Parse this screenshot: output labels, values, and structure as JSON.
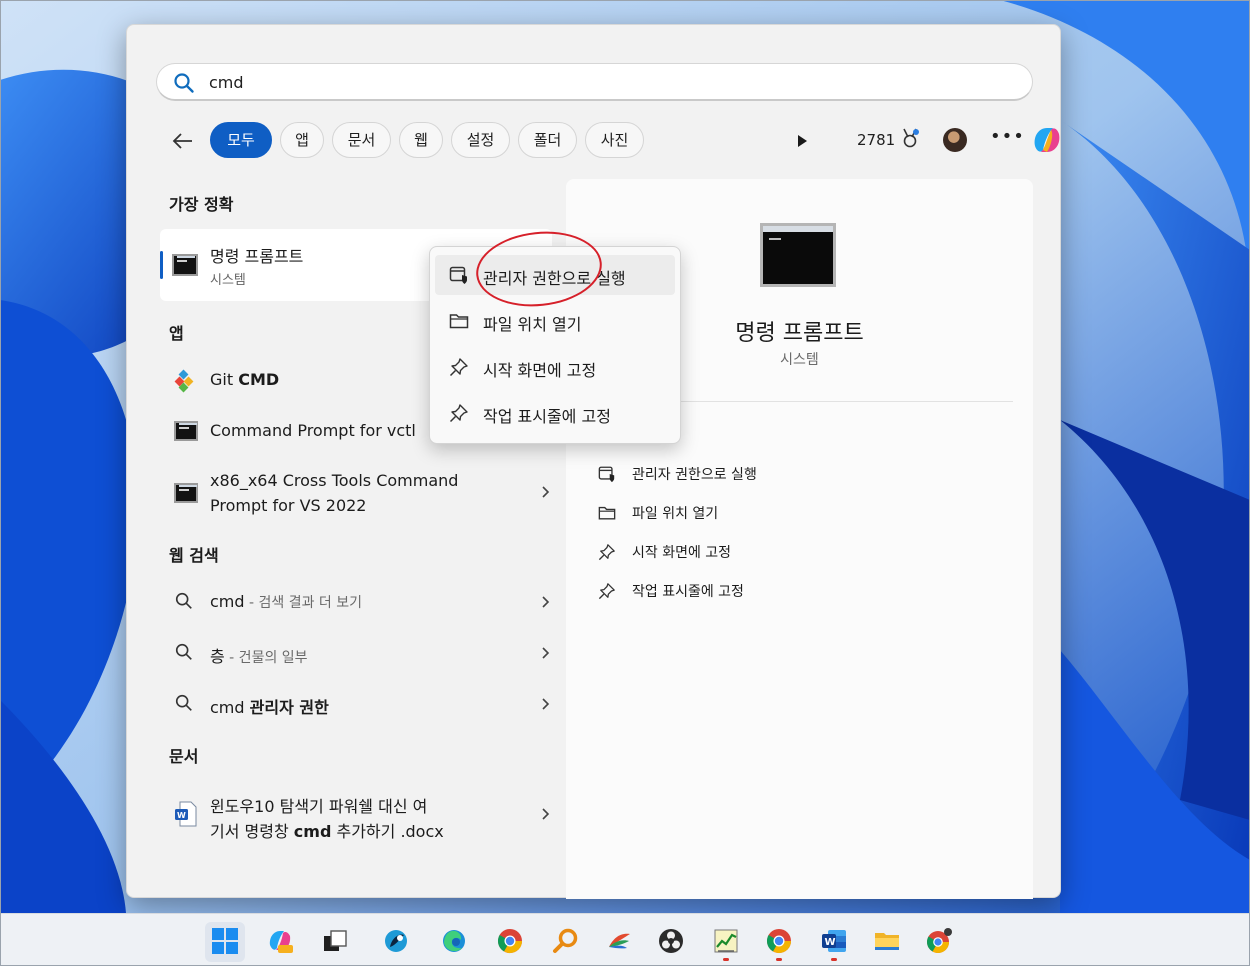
{
  "search": {
    "query": "cmd",
    "placeholder": ""
  },
  "filters": {
    "tabs": [
      "모두",
      "앱",
      "문서",
      "웹",
      "설정",
      "폴더",
      "사진"
    ],
    "active_index": 0,
    "points": "2781"
  },
  "sections": {
    "best_match": "가장 정확",
    "apps": "앱",
    "web": "웹 검색",
    "documents": "문서"
  },
  "best_match": {
    "title": "명령 프롬프트",
    "subtitle": "시스템"
  },
  "apps": [
    {
      "title_prefix": "Git ",
      "title_bold": "CMD"
    },
    {
      "title": "Command Prompt for vctl"
    },
    {
      "title_line1": "x86_x64 Cross Tools Command",
      "title_line2": "Prompt for VS 2022"
    }
  ],
  "web": [
    {
      "query": "cmd",
      "suffix": " - 검색 결과 더 보기"
    },
    {
      "query": "층",
      "suffix": " - 건물의 일부"
    },
    {
      "query_prefix": "cmd ",
      "query_bold": "관리자 권한"
    }
  ],
  "documents": [
    {
      "line1": "윈도우10 탐색기 파워쉘 대신 여",
      "line2_prefix": "기서 명령창 ",
      "line2_bold": "cmd",
      "line2_suffix": " 추가하기 .docx"
    }
  ],
  "context_menu": [
    {
      "label": "관리자 권한으로 실행",
      "icon": "shield-run-icon"
    },
    {
      "label": "파일 위치 열기",
      "icon": "folder-icon"
    },
    {
      "label": "시작 화면에 고정",
      "icon": "pin-icon"
    },
    {
      "label": "작업 표시줄에 고정",
      "icon": "pin-icon"
    }
  ],
  "preview": {
    "title": "명령 프롬프트",
    "subtitle": "시스템",
    "actions": [
      {
        "label": "관리자 권한으로 실행",
        "icon": "shield-run-icon"
      },
      {
        "label": "파일 위치 열기",
        "icon": "folder-icon"
      },
      {
        "label": "시작 화면에 고정",
        "icon": "pin-icon"
      },
      {
        "label": "작업 표시줄에 고정",
        "icon": "pin-icon"
      }
    ]
  },
  "taskbar": {
    "apps": [
      "start-icon",
      "copilot-pre-icon",
      "task-view-icon",
      "app-icon",
      "edge-icon",
      "chrome-icon",
      "search-app-icon",
      "feather-app-icon",
      "obs-icon",
      "chart-app-icon",
      "chrome-icon",
      "word-icon",
      "file-explorer-icon",
      "chrome-canary-icon"
    ]
  },
  "colors": {
    "accent": "#0f5ec4",
    "highlight_circle": "#d6202a"
  }
}
